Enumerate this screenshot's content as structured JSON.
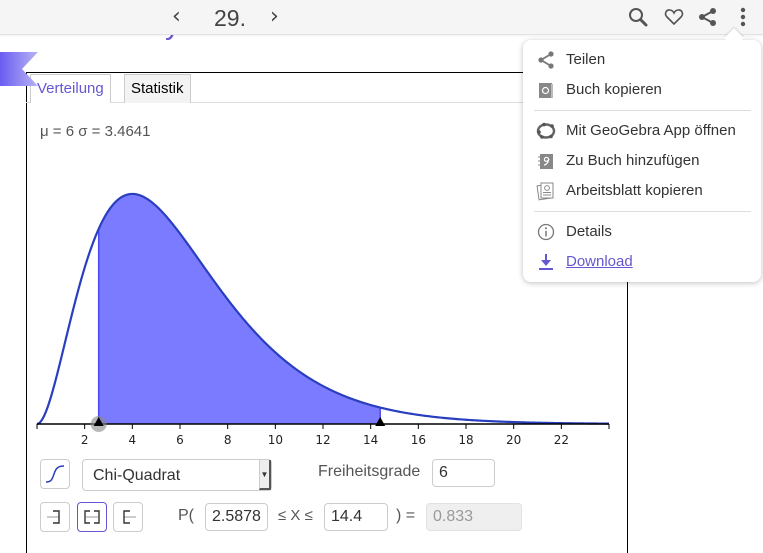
{
  "topbar": {
    "prev_label": "‹",
    "page_number": "29.",
    "next_label": "›",
    "icons": [
      "search-icon",
      "heart-icon",
      "share-icon",
      "more-vertical-icon"
    ]
  },
  "page_title": "Probability Calculator",
  "tabs": [
    {
      "label": "Verteilung",
      "active": true
    },
    {
      "label": "Statistik",
      "active": false
    }
  ],
  "stats_text": "μ = 6 σ = 3.4641",
  "chart_data": {
    "type": "area",
    "distribution": "chi-squared",
    "degrees_of_freedom": 6,
    "shaded_interval": [
      2.5878,
      14.4
    ],
    "x_ticks": [
      2,
      4,
      6,
      8,
      10,
      12,
      14,
      16,
      18,
      20,
      22
    ],
    "x_range": [
      0,
      24
    ],
    "y_range": [
      0,
      0.1353
    ],
    "title": "",
    "xlabel": "",
    "ylabel": "",
    "fill_color": "#7b7bff",
    "line_color": "#2a3fbf"
  },
  "controls": {
    "cumulative_toggle_icon": "cdf-curve-icon",
    "distribution_select": "Chi-Quadrat",
    "param_label": "Freiheitsgrade",
    "param_value": "6",
    "interval_buttons": [
      {
        "name": "left-sided",
        "selected": false
      },
      {
        "name": "interval",
        "selected": true
      },
      {
        "name": "right-sided",
        "selected": false
      }
    ],
    "prob_prefix": "P(",
    "lower_value": "2.5878",
    "middle_label": "≤ X ≤",
    "upper_value": "14.4",
    "equals_label": ") =",
    "result_value": "0.833"
  },
  "menu": {
    "items": [
      {
        "label": "Teilen",
        "icon": "share-icon"
      },
      {
        "label": "Buch kopieren",
        "icon": "copy-book-icon"
      },
      {
        "label": "Mit GeoGebra App öffnen",
        "icon": "geogebra-app-icon"
      },
      {
        "label": "Zu Buch hinzufügen",
        "icon": "add-to-book-icon"
      },
      {
        "label": "Arbeitsblatt kopieren",
        "icon": "copy-worksheet-icon"
      },
      {
        "label": "Details",
        "icon": "info-icon"
      },
      {
        "label": "Download",
        "icon": "download-icon"
      }
    ]
  },
  "colors": {
    "accent": "#6557d2",
    "link": "#6557d2"
  }
}
